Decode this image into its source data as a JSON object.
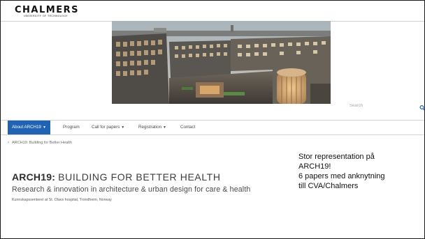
{
  "header": {
    "logo_text": "CHALMERS",
    "logo_subtext": "UNIVERSITY OF TECHNOLOGY"
  },
  "hero": {
    "icon": "building-courtyard-photo"
  },
  "search": {
    "placeholder": "Search",
    "icon": "search-icon"
  },
  "nav": {
    "items": [
      {
        "label": "About ARCH19",
        "dropdown": true,
        "active": true
      },
      {
        "label": "Program",
        "dropdown": false,
        "active": false
      },
      {
        "label": "Call for papers",
        "dropdown": true,
        "active": false
      },
      {
        "label": "Registration",
        "dropdown": true,
        "active": false
      },
      {
        "label": "Contact",
        "dropdown": false,
        "active": false
      }
    ],
    "active_color": "#1f63b2"
  },
  "breadcrumb": {
    "text": "ARCH19: Building for Better Health"
  },
  "page": {
    "title_bold": "ARCH19:",
    "title_rest": "BUILDING FOR BETTER HEALTH",
    "subtitle": "Research & innovation in architecture & urban design for care & health",
    "small_line": "Kunnskapssenteret at St. Olavs hospital, Trondheim, Norway"
  },
  "note": {
    "line1": "Stor representation på",
    "line2": "ARCH19!",
    "line3": "6 papers med anknytning",
    "line4": "till CVA/Chalmers"
  }
}
